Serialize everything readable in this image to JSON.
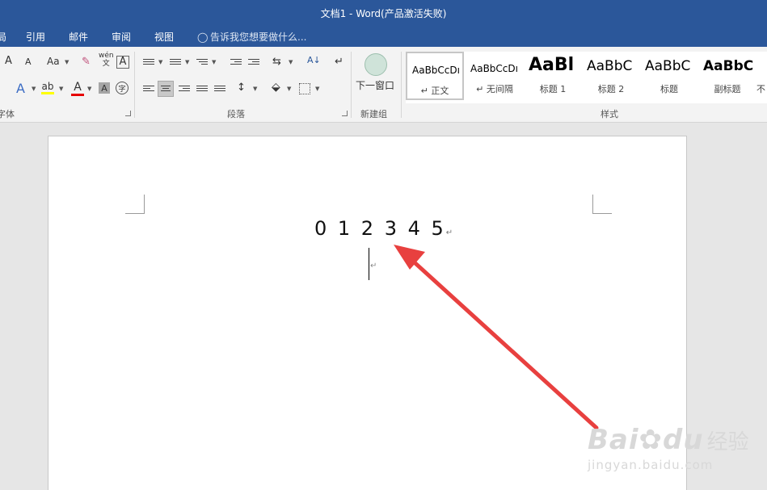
{
  "window": {
    "title": "文档1 - Word(产品激活失败)"
  },
  "menu": {
    "tabs": [
      "局",
      "引用",
      "邮件",
      "审阅",
      "视图"
    ],
    "tell_me": "告诉我您想要做什么..."
  },
  "ribbon": {
    "groups": {
      "font": "字体",
      "paragraph": "段落",
      "new_group": "新建组",
      "styles": "样式"
    },
    "font": {
      "grow": "A",
      "shrink": "A",
      "change_case": "Aa",
      "phonetic_top": "wén",
      "phonetic_bottom": "文",
      "char_border": "A",
      "effects": "A",
      "highlight": "ab",
      "font_color": "A",
      "shading": "A",
      "enclose": "字"
    },
    "paragraph": {
      "sort": "A↓",
      "show_marks": "↵"
    },
    "new_window_label": "下一窗口",
    "styles": [
      {
        "sample": "AaBbCcDı",
        "name": "↵ 正文"
      },
      {
        "sample": "AaBbCcDı",
        "name": "↵ 无间隔"
      },
      {
        "sample": "AaBl",
        "name": "标题 1"
      },
      {
        "sample": "AaBbC",
        "name": "标题 2"
      },
      {
        "sample": "AaBbC",
        "name": "标题"
      },
      {
        "sample": "AaBbC",
        "name": "副标题"
      },
      {
        "sample": "",
        "name": "不"
      }
    ]
  },
  "document": {
    "line1": "0 1 2 3 4 5",
    "paragraph_mark": "↵"
  },
  "watermark": {
    "brand": "Bai",
    "brand_du": "du",
    "brand_cn": "经验",
    "url": "jingyan.baidu.com"
  },
  "colors": {
    "titlebar": "#2b579a",
    "arrow": "#e8403f",
    "highlight_yellow": "#ffff00",
    "font_red": "#e60000"
  }
}
